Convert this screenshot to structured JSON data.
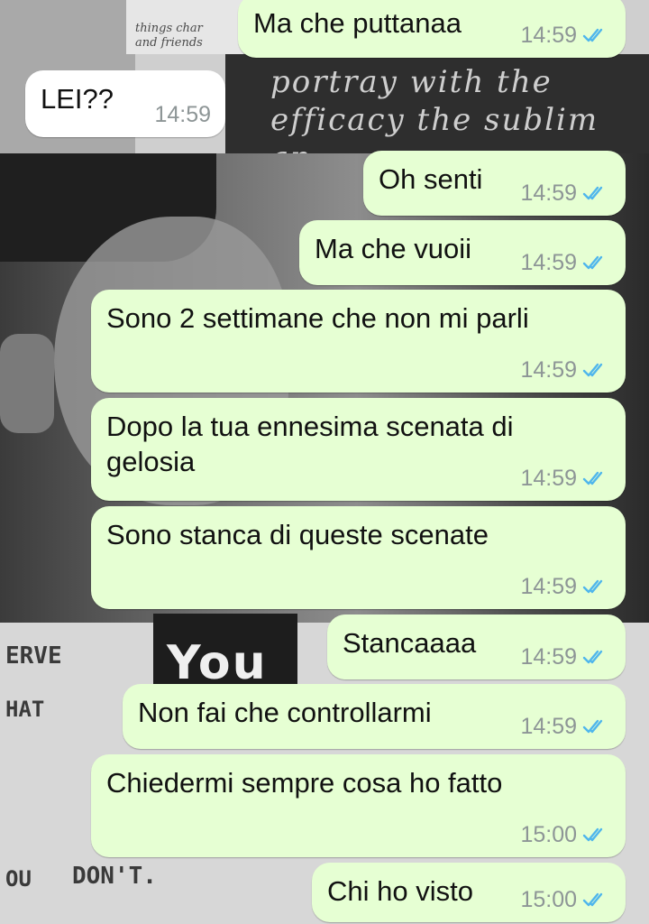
{
  "theme": {
    "outgoing_bubble": "#e6ffd3",
    "incoming_bubble": "#ffffff",
    "time_color": "#8d9596",
    "read_tick_color": "#4fb6ec"
  },
  "background": {
    "text_small": "things char\nand friends",
    "text_script": "portray with the\nefficacy the sublim\nan",
    "text_w1": "ERVE",
    "text_w2": "HAT",
    "text_w3": "OU",
    "text_w4": "DON'T.",
    "text_you": "You"
  },
  "messages": [
    {
      "direction": "out",
      "text": "Ma che puttanaa",
      "time": "14:59",
      "status": "read-ticks-icon"
    },
    {
      "direction": "in",
      "text": "LEI??",
      "time": "14:59"
    },
    {
      "direction": "out",
      "text": "Oh senti",
      "time": "14:59",
      "status": "read-ticks-icon"
    },
    {
      "direction": "out",
      "text": "Ma che vuoii",
      "time": "14:59",
      "status": "read-ticks-icon"
    },
    {
      "direction": "out",
      "text": "Sono 2 settimane che non mi parli",
      "time": "14:59",
      "status": "read-ticks-icon"
    },
    {
      "direction": "out",
      "text": "Dopo la tua ennesima scenata di\ngelosia",
      "time": "14:59",
      "status": "read-ticks-icon"
    },
    {
      "direction": "out",
      "text": "Sono stanca di queste scenate",
      "time": "14:59",
      "status": "read-ticks-icon"
    },
    {
      "direction": "out",
      "text": "Stancaaaa",
      "time": "14:59",
      "status": "read-ticks-icon"
    },
    {
      "direction": "out",
      "text": "Non fai che controllarmi",
      "time": "14:59",
      "status": "read-ticks-icon"
    },
    {
      "direction": "out",
      "text": "Chiedermi sempre cosa ho fatto",
      "time": "15:00",
      "status": "read-ticks-icon"
    },
    {
      "direction": "out",
      "text": "Chi ho visto",
      "time": "15:00",
      "status": "read-ticks-icon"
    }
  ]
}
